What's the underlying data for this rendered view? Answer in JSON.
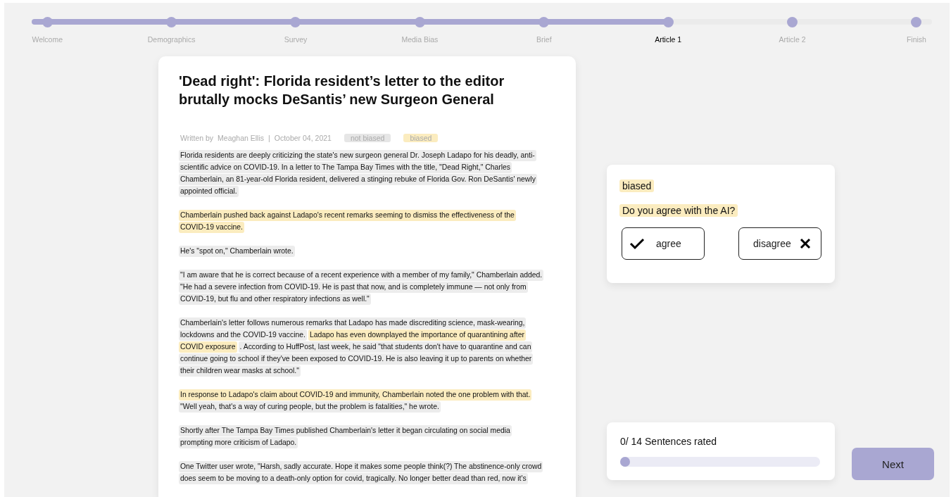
{
  "progress_steps": [
    {
      "label": "Welcome",
      "done": true,
      "selected": false
    },
    {
      "label": "Demographics",
      "done": true,
      "selected": false
    },
    {
      "label": "Survey",
      "done": true,
      "selected": false
    },
    {
      "label": "Media Bias",
      "done": true,
      "selected": false
    },
    {
      "label": "Brief",
      "done": true,
      "selected": false
    },
    {
      "label": "Article 1",
      "done": true,
      "selected": true
    },
    {
      "label": "Article 2",
      "done": false,
      "selected": false
    },
    {
      "label": "Finish",
      "done": false,
      "selected": false
    }
  ],
  "article": {
    "title": "'Dead right': Florida resident’s letter to the editor brutally mocks DeSantis’ new Surgeon General",
    "byline_prefix": "Written by",
    "author": "Meaghan Ellis",
    "separator": "|",
    "date": "October 04, 2021",
    "legend": [
      {
        "label": "not biased",
        "biased": false
      },
      {
        "label": "biased",
        "biased": true
      }
    ],
    "paragraphs": [
      {
        "lines": [
          {
            "segments": [
              {
                "text": "Florida residents are deeply criticizing the state's new surgeon general Dr. Joseph Ladapo for his deadly, anti-",
                "biased": false
              }
            ]
          },
          {
            "segments": [
              {
                "text": "scientific advice on COVID-19. In a letter to The Tampa Bay Times with the title, \"Dead Right,\" Charles",
                "biased": false
              }
            ]
          },
          {
            "segments": [
              {
                "text": "Chamberlain, an 81-year-old Florida resident, delivered a stinging rebuke of Florida Gov. Ron DeSantis' newly",
                "biased": false
              }
            ]
          },
          {
            "segments": [
              {
                "text": "appointed official.",
                "biased": false
              }
            ]
          }
        ]
      },
      {
        "lines": [
          {
            "segments": [
              {
                "text": "Chamberlain pushed back against Ladapo's recent remarks seeming to dismiss the effectiveness of the",
                "biased": true
              }
            ]
          },
          {
            "segments": [
              {
                "text": "COVID-19 vaccine.",
                "biased": true
              }
            ]
          }
        ]
      },
      {
        "lines": [
          {
            "segments": [
              {
                "text": "He's \"spot on,\" Chamberlain wrote.",
                "biased": false
              }
            ]
          }
        ]
      },
      {
        "lines": [
          {
            "segments": [
              {
                "text": "\"I am aware that he is correct because of a recent experience with a member of my family,\" Chamberlain added.",
                "biased": false
              }
            ]
          },
          {
            "segments": [
              {
                "text": "\"He had a severe infection from COVID-19. He is past that now, and is completely immune — not only from",
                "biased": false
              }
            ]
          },
          {
            "segments": [
              {
                "text": "COVID-19, but flu and other respiratory infections as well.\"",
                "biased": false
              }
            ]
          }
        ]
      },
      {
        "lines": [
          {
            "segments": [
              {
                "text": "Chamberlain's letter follows numerous remarks that Ladapo has made discrediting science, mask-wearing,",
                "biased": false
              }
            ]
          },
          {
            "segments": [
              {
                "text": "lockdowns and the COVID-19 vaccine.",
                "biased": false
              },
              {
                "text": "Ladapo has even downplayed the importance of quarantining after",
                "biased": true
              }
            ]
          },
          {
            "segments": [
              {
                "text": "COVID exposure",
                "biased": true
              },
              {
                "text": ". According to HuffPost, last week, he said \"that students don't have to quarantine and can",
                "biased": false
              }
            ]
          },
          {
            "segments": [
              {
                "text": "continue going to school if they've been exposed to COVID-19. He is also leaving it up to parents on whether",
                "biased": false
              }
            ]
          },
          {
            "segments": [
              {
                "text": "their children wear masks at school.\"",
                "biased": false
              }
            ]
          }
        ]
      },
      {
        "lines": [
          {
            "segments": [
              {
                "text": "In response to Ladapo's claim about COVID-19 and immunity, Chamberlain noted the one problem with that.",
                "biased": true
              }
            ]
          },
          {
            "segments": [
              {
                "text": "\"Well yeah, that's a way of curing people, but the problem is fatalities,\" he wrote.",
                "biased": false
              }
            ]
          }
        ]
      },
      {
        "lines": [
          {
            "segments": [
              {
                "text": "Shortly after The Tampa Bay Times published Chamberlain's letter it began circulating on social media",
                "biased": false
              }
            ]
          },
          {
            "segments": [
              {
                "text": "prompting more criticism of Ladapo.",
                "biased": false
              }
            ]
          }
        ]
      },
      {
        "lines": [
          {
            "segments": [
              {
                "text": "One Twitter user wrote, \"Harsh, sadly accurate. Hope it makes some people think(?) The abstinence-only crowd",
                "biased": false
              }
            ]
          },
          {
            "segments": [
              {
                "text": "does seem to be moving to a death-only option for covid, tragically. No longer better dead than red, now it's",
                "biased": false
              }
            ]
          }
        ]
      }
    ]
  },
  "rating_card": {
    "label": "biased",
    "biased": true,
    "question": "Do you agree with the AI?",
    "buttons": [
      {
        "label": "agree",
        "kind": "agree"
      },
      {
        "label": "disagree",
        "kind": "disagree"
      }
    ]
  },
  "rating_progress": {
    "text": "0/ 14 Sentences rated",
    "level": 0
  },
  "next_button": {
    "label": "Next"
  }
}
